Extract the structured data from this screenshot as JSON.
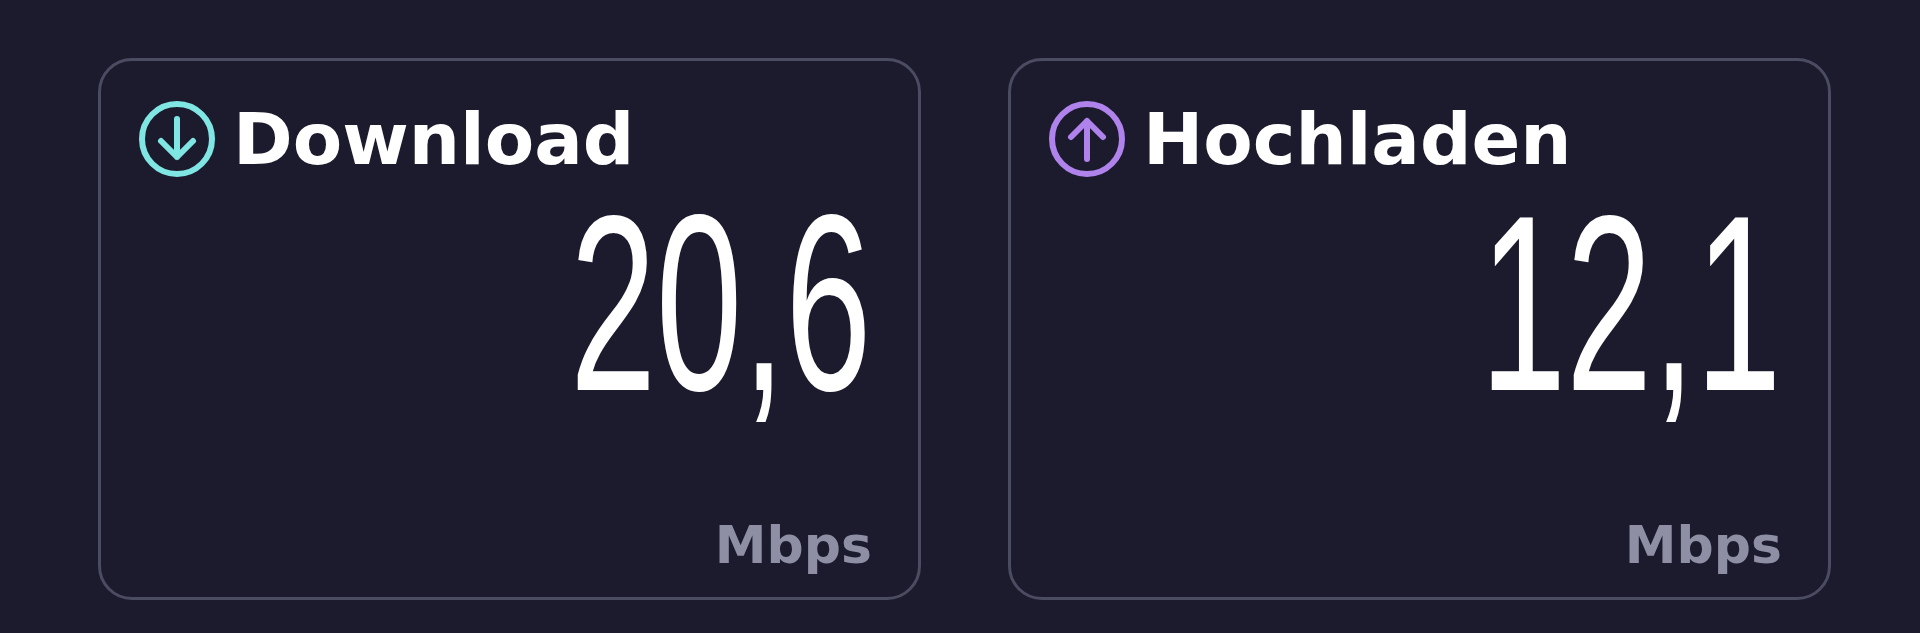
{
  "cards": [
    {
      "kind": "download",
      "title": "Download",
      "value": "20,6",
      "unit": "Mbps",
      "color": "#7fe6e4"
    },
    {
      "kind": "upload",
      "title": "Hochladen",
      "value": "12,1",
      "unit": "Mbps",
      "color": "#b083ec"
    }
  ]
}
